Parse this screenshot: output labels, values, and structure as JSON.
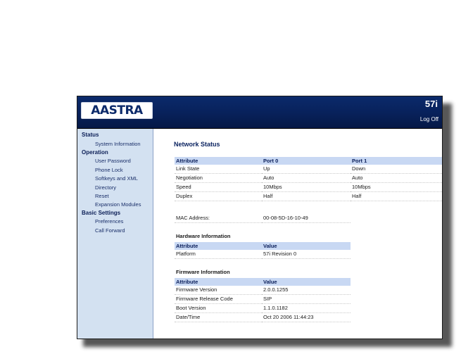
{
  "header": {
    "logo_text": "AASTRA",
    "model": "57i",
    "logoff_label": "Log Off"
  },
  "sidebar": {
    "status": {
      "label": "Status",
      "items": [
        "System Information"
      ]
    },
    "operation": {
      "label": "Operation",
      "items": [
        "User Password",
        "Phone Lock",
        "Softkeys and XML",
        "Directory",
        "Reset",
        "Expansion Modules"
      ]
    },
    "basic_settings": {
      "label": "Basic Settings",
      "items": [
        "Preferences",
        "Call Forward"
      ]
    }
  },
  "main": {
    "title": "Network Status",
    "network": {
      "headers": [
        "Attribute",
        "Port 0",
        "Port 1"
      ],
      "rows": [
        [
          "Link State",
          "Up",
          "Down"
        ],
        [
          "Negotiation",
          "Auto",
          "Auto"
        ],
        [
          "Speed",
          "10Mbps",
          "10Mbps"
        ],
        [
          "Duplex",
          "Half",
          "Half"
        ]
      ],
      "mac_label": "MAC Address:",
      "mac_value": "00-08-5D-16-10-49"
    },
    "hardware": {
      "title": "Hardware Information",
      "headers": [
        "Attribute",
        "Value"
      ],
      "rows": [
        [
          "Platform",
          "57i Revision 0"
        ]
      ]
    },
    "firmware": {
      "title": "Firmware Information",
      "headers": [
        "Attribute",
        "Value"
      ],
      "rows": [
        [
          "Firmware Version",
          "2.0.0.1255"
        ],
        [
          "Firmware Release Code",
          "SIP"
        ],
        [
          "Boot Version",
          "1.1.0.1182"
        ],
        [
          "Date/Time",
          "Oct 20 2006 11:44:23"
        ]
      ]
    }
  },
  "colors": {
    "header_bg": "#08215a",
    "sidebar_bg": "#d3e1f1",
    "table_header_bg": "#c8d8f3",
    "title_color": "#0c2461"
  }
}
